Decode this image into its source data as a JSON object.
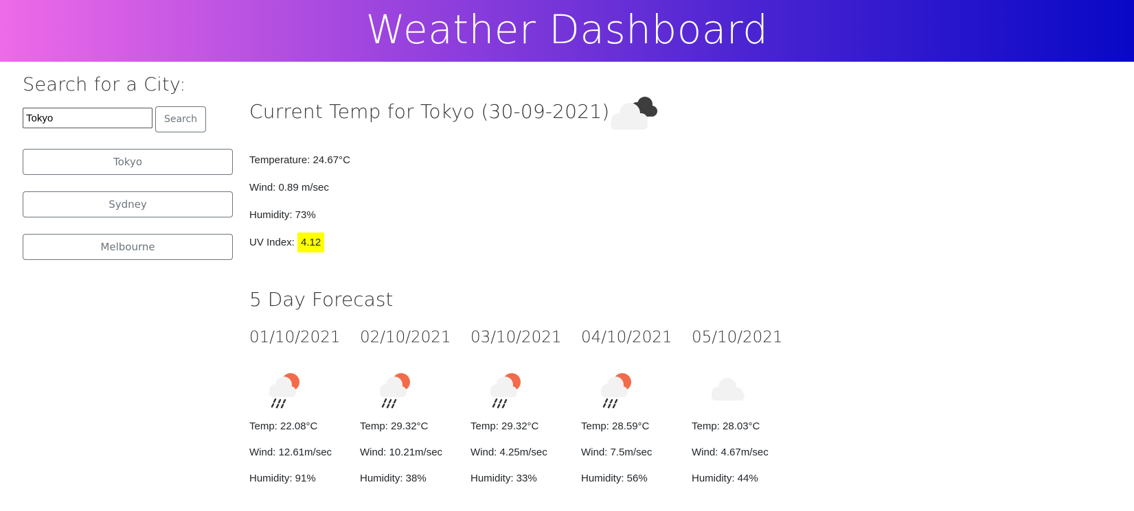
{
  "header": {
    "title": "Weather Dashboard"
  },
  "sidebar": {
    "title": "Search for a City:",
    "search": {
      "value": "Tokyo",
      "button_label": "Search"
    },
    "history": [
      {
        "label": "Tokyo"
      },
      {
        "label": "Sydney"
      },
      {
        "label": "Melbourne"
      }
    ]
  },
  "current": {
    "title": "Current Temp for Tokyo (30-09-2021)",
    "icon": "cloudy-icon",
    "temperature": "Temperature: 24.67°C",
    "wind": "Wind: 0.89 m/sec",
    "humidity": "Humidity: 73%",
    "uv_label": "UV Index:",
    "uv_value": "4.12",
    "uv_color": "#ffff00"
  },
  "forecast": {
    "title": "5 Day Forecast",
    "days": [
      {
        "date": "01/10/2021",
        "icon": "sun-rain-cloud-icon",
        "temp": "Temp: 22.08°C",
        "wind": "Wind: 12.61m/sec",
        "humidity": "Humidity: 91%"
      },
      {
        "date": "02/10/2021",
        "icon": "sun-rain-cloud-icon",
        "temp": "Temp: 29.32°C",
        "wind": "Wind: 10.21m/sec",
        "humidity": "Humidity: 38%"
      },
      {
        "date": "03/10/2021",
        "icon": "sun-rain-cloud-icon",
        "temp": "Temp: 29.32°C",
        "wind": "Wind: 4.25m/sec",
        "humidity": "Humidity: 33%"
      },
      {
        "date": "04/10/2021",
        "icon": "sun-rain-cloud-icon",
        "temp": "Temp: 28.59°C",
        "wind": "Wind: 7.5m/sec",
        "humidity": "Humidity: 56%"
      },
      {
        "date": "05/10/2021",
        "icon": "cloud-icon",
        "temp": "Temp: 28.03°C",
        "wind": "Wind: 4.67m/sec",
        "humidity": "Humidity: 44%"
      }
    ]
  },
  "colors": {
    "header_gradient_start": "#ee6ae8",
    "header_gradient_end": "#0808c6",
    "button_border": "#6c757d",
    "sun": "#f26b4a"
  }
}
